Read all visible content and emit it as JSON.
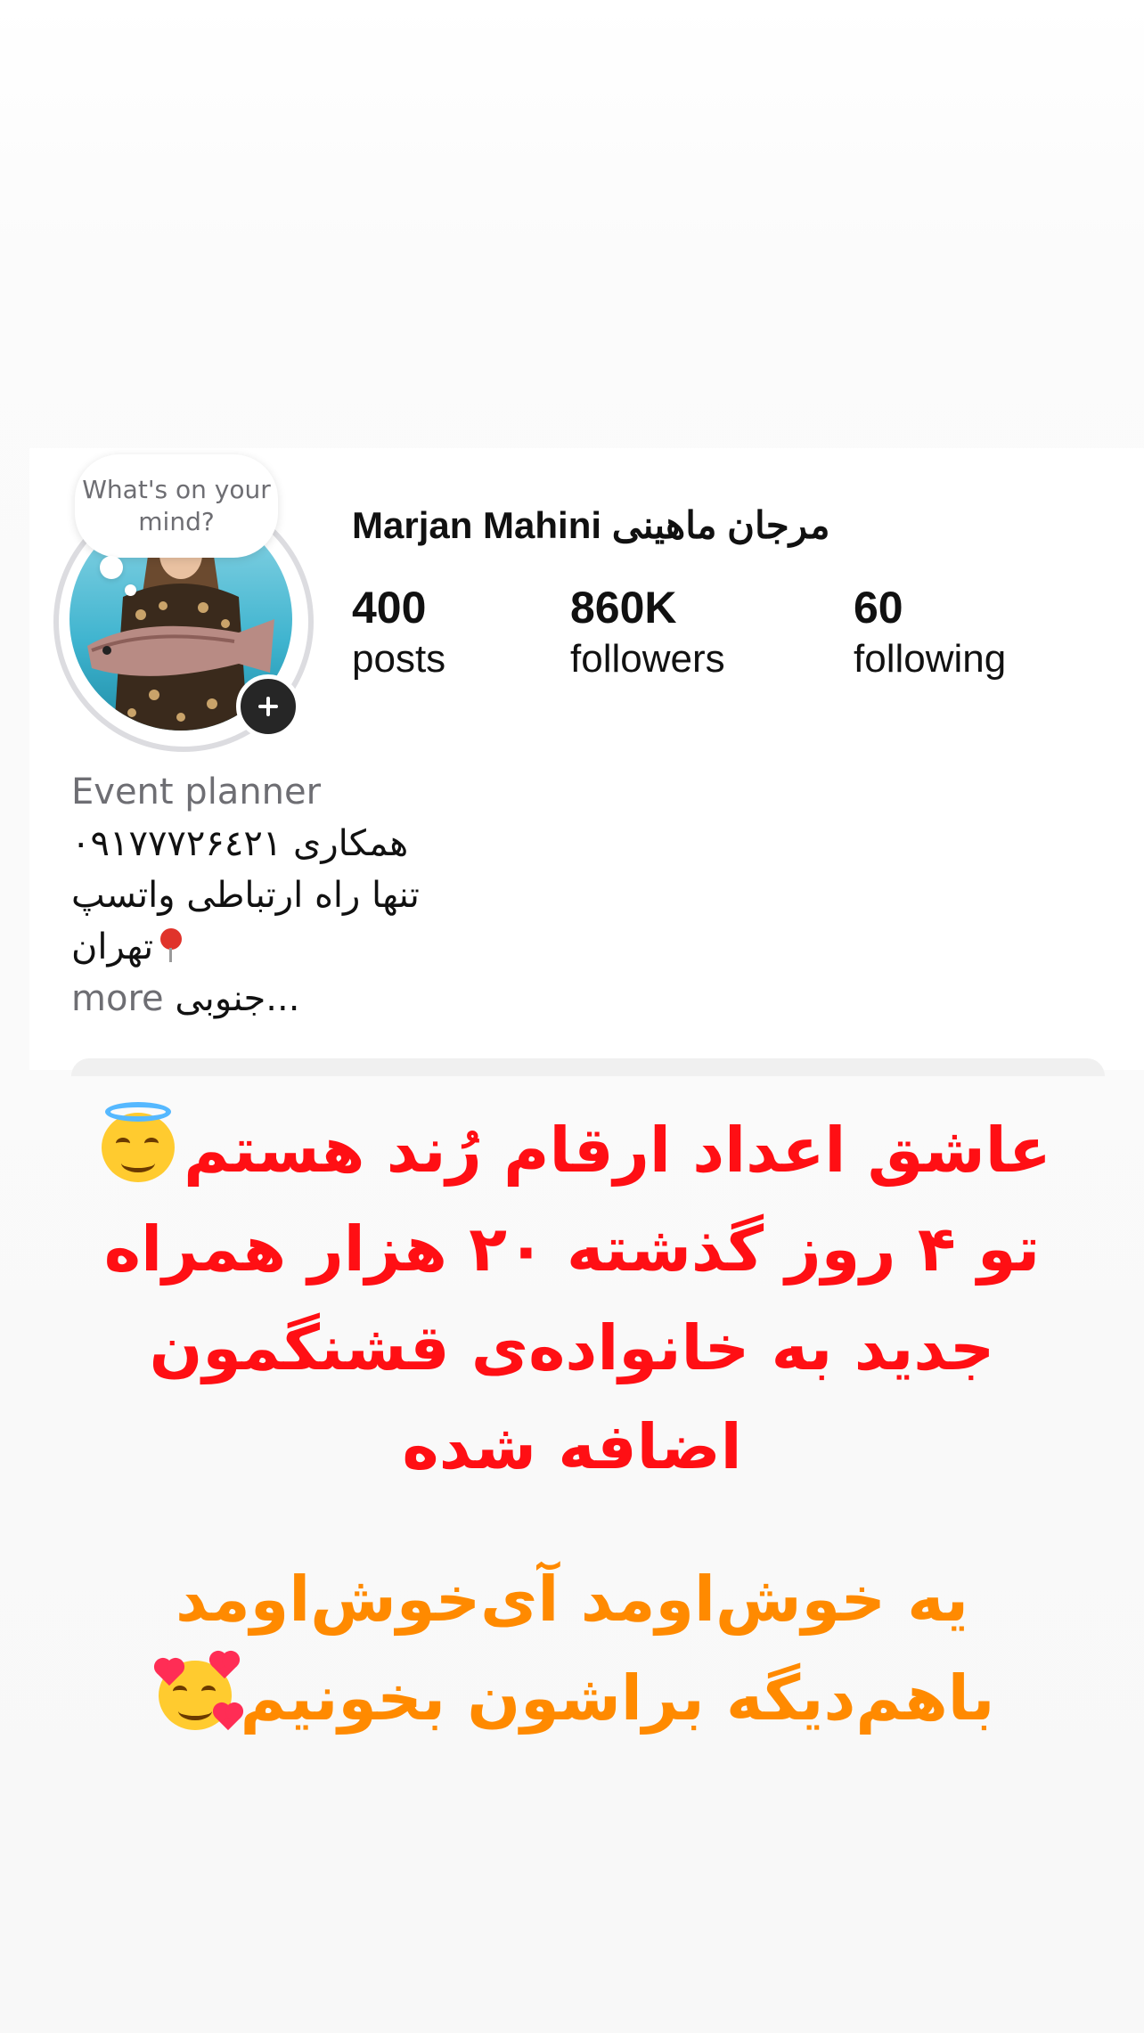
{
  "note": {
    "text": "What's on your mind?"
  },
  "profile": {
    "display_name": "Marjan Mahini مرجان ماهینی",
    "stats": [
      {
        "value": "400",
        "label": "posts"
      },
      {
        "value": "860K",
        "label": "followers"
      },
      {
        "value": "60",
        "label": "following"
      }
    ],
    "bio": {
      "category": "Event planner",
      "line1": "۰۹۱۷۷۷۲۶٤۲۱ همکاری",
      "line2": "تنها راه ارتباطی واتسپ",
      "line3": "تهران",
      "line4_text": "جنوبی...",
      "more": "more"
    }
  },
  "story": {
    "red_lines": [
      "عاشق اعداد ارقام رُند هستم",
      "تو ۴ روز گذشته ۲۰ هزار همراه",
      "جدید به خانواده‌ی قشنگمون",
      "اضافه شده"
    ],
    "orange_lines": [
      "یه خوش‌اومد آی‌خوش‌اومد",
      "باهم‌دیگه  براشون بخونیم"
    ],
    "red_color": "#ff0f14",
    "orange_color": "#ff8a00",
    "emoji_1": "smiling-face-with-halo",
    "emoji_2": "smiling-face-with-hearts"
  }
}
